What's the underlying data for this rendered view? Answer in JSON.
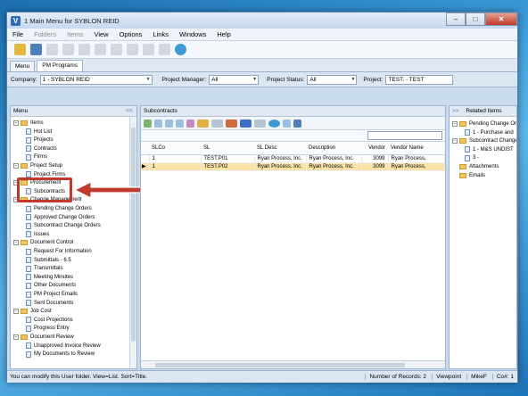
{
  "window": {
    "app_icon": "V",
    "title": "1 Main Menu for SYBLON REID",
    "controls": [
      "–",
      "□",
      "✕"
    ]
  },
  "menu": [
    "File",
    "Folders",
    "Items",
    "View",
    "Options",
    "Links",
    "Windows",
    "Help"
  ],
  "tabs": [
    "Menu",
    "PM Programs"
  ],
  "filters": {
    "company_label": "Company:",
    "company_value": "1 - SYBLON REID",
    "pm_label": "Project Manager:",
    "pm_value": "All",
    "status_label": "Project Status:",
    "status_value": "All",
    "project_label": "Project:",
    "project_value": "TEST. - TEST"
  },
  "left_panel": {
    "title": "Menu",
    "chevron": "<<",
    "tree": [
      {
        "label": "Items",
        "type": "folder",
        "level": 0,
        "expander": "−"
      },
      {
        "label": "Hot List",
        "type": "doc",
        "level": 1
      },
      {
        "label": "Projects",
        "type": "doc",
        "level": 1
      },
      {
        "label": "Contracts",
        "type": "doc",
        "level": 1
      },
      {
        "label": "Firms",
        "type": "doc",
        "level": 1
      },
      {
        "label": "Project Setup",
        "type": "folder",
        "level": 0,
        "expander": "−"
      },
      {
        "label": "Project Firms",
        "type": "doc",
        "level": 1
      },
      {
        "label": "Procurement",
        "type": "folder",
        "level": 0,
        "expander": "−"
      },
      {
        "label": "Subcontracts",
        "type": "doc",
        "level": 1
      },
      {
        "label": "Change Management",
        "type": "folder",
        "level": 0,
        "expander": "−"
      },
      {
        "label": "Pending Change Orders",
        "type": "doc",
        "level": 1
      },
      {
        "label": "Approved Change Orders",
        "type": "doc",
        "level": 1
      },
      {
        "label": "Subcontract Change Orders",
        "type": "doc",
        "level": 1
      },
      {
        "label": "Issues",
        "type": "doc",
        "level": 1
      },
      {
        "label": "Document Control",
        "type": "folder",
        "level": 0,
        "expander": "−"
      },
      {
        "label": "Request For Information",
        "type": "doc",
        "level": 1
      },
      {
        "label": "Submittals - 6.5",
        "type": "doc",
        "level": 1
      },
      {
        "label": "Transmittals",
        "type": "doc",
        "level": 1
      },
      {
        "label": "Meeting Minutes",
        "type": "doc",
        "level": 1
      },
      {
        "label": "Other Documents",
        "type": "doc",
        "level": 1
      },
      {
        "label": "PM Project Emails",
        "type": "doc",
        "level": 1
      },
      {
        "label": "Sent Documents",
        "type": "doc",
        "level": 1
      },
      {
        "label": "Job Cost",
        "type": "folder",
        "level": 0,
        "expander": "−"
      },
      {
        "label": "Cost Projections",
        "type": "doc",
        "level": 1
      },
      {
        "label": "Progress Entry",
        "type": "doc",
        "level": 1
      },
      {
        "label": "Document Review",
        "type": "folder",
        "level": 0,
        "expander": "−"
      },
      {
        "label": "Unapproved Invoice Review",
        "type": "doc",
        "level": 1
      },
      {
        "label": "My Documents to Review",
        "type": "doc",
        "level": 1
      }
    ]
  },
  "mid_panel": {
    "title": "Subcontracts",
    "columns": [
      "SLCo",
      "SL",
      "SL Desc",
      "Description",
      "Vendor",
      "Vendor Name"
    ],
    "rows": [
      {
        "mark": "",
        "cells": [
          "1",
          "TEST.P01",
          "Ryan Process, Inc.",
          "Ryan Process, Inc.",
          "3099",
          "Ryan Process,"
        ]
      },
      {
        "mark": "▶",
        "cells": [
          "1",
          "TEST.P02",
          "Ryan Process, Inc.",
          "Ryan Process, Inc.",
          "3099",
          "Ryan Process,"
        ]
      }
    ]
  },
  "right_panel": {
    "title": "Related Items",
    "chevron": ">>",
    "items": [
      {
        "label": "Pending Change Or",
        "type": "folder",
        "level": 0,
        "expander": "−"
      },
      {
        "label": "1 - Purchase and",
        "type": "doc",
        "level": 1
      },
      {
        "label": "Subcontract Change",
        "type": "folder",
        "level": 0,
        "expander": "−"
      },
      {
        "label": "1 - M&S UNDIST",
        "type": "doc",
        "level": 1
      },
      {
        "label": "3 -",
        "type": "doc",
        "level": 1
      },
      {
        "label": "Attachments",
        "type": "folder",
        "level": 0
      },
      {
        "label": "Emails",
        "type": "folder",
        "level": 0
      }
    ]
  },
  "status": {
    "message": "You can modify this User folder. View=List. Sort=Title.",
    "records": "Number of Records: 2",
    "viewpoint": "Viewpoint",
    "user": "MikeF",
    "co": "Co#: 1"
  },
  "colors": {
    "highlight_red": "#c0392b",
    "selected_row": "#fbe3a7",
    "folder_yellow": "#f2c45a"
  }
}
